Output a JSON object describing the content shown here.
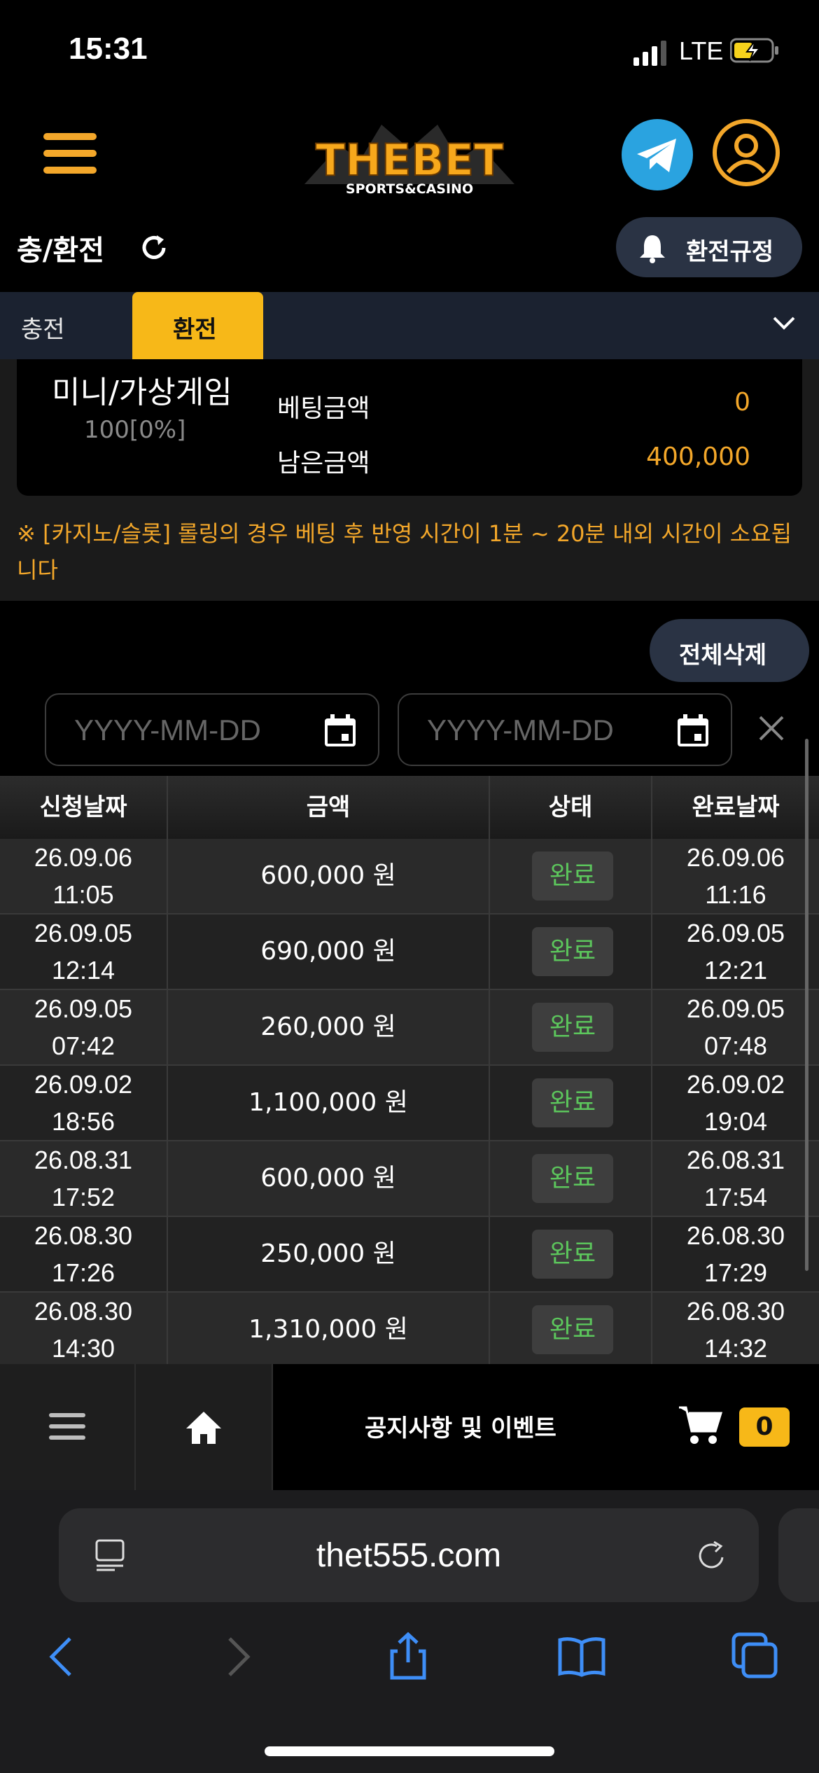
{
  "status_bar": {
    "time": "15:31",
    "network": "LTE"
  },
  "header": {
    "logo_main": "THEBET",
    "logo_sub": "SPORTS&CASINO"
  },
  "page": {
    "title": "충/환전",
    "rules_button": "환전규정"
  },
  "tabs": [
    {
      "label": "충전",
      "active": false
    },
    {
      "label": "환전",
      "active": true
    }
  ],
  "summary": {
    "game_name": "미니/가상게임",
    "game_rate": "100[0%]",
    "rows": [
      {
        "label": "베팅금액",
        "value": "0"
      },
      {
        "label": "남은금액",
        "value": "400,000"
      }
    ]
  },
  "notice": "※ [카지노/슬롯] 롤링의 경우 베팅 후 반영 시간이 1분 ~ 20분 내외 시간이 소요됩니다",
  "delete_all_button": "전체삭제",
  "filters": {
    "start_placeholder": "YYYY-MM-DD",
    "end_placeholder": "YYYY-MM-DD"
  },
  "table": {
    "headers": [
      "신청날짜",
      "금액",
      "상태",
      "완료날짜"
    ],
    "rows": [
      {
        "req_date": "26.09.06",
        "req_time": "11:05",
        "amount": "600,000 원",
        "status": "완료",
        "done_date": "26.09.06",
        "done_time": "11:16"
      },
      {
        "req_date": "26.09.05",
        "req_time": "12:14",
        "amount": "690,000 원",
        "status": "완료",
        "done_date": "26.09.05",
        "done_time": "12:21"
      },
      {
        "req_date": "26.09.05",
        "req_time": "07:42",
        "amount": "260,000 원",
        "status": "완료",
        "done_date": "26.09.05",
        "done_time": "07:48"
      },
      {
        "req_date": "26.09.02",
        "req_time": "18:56",
        "amount": "1,100,000 원",
        "status": "완료",
        "done_date": "26.09.02",
        "done_time": "19:04"
      },
      {
        "req_date": "26.08.31",
        "req_time": "17:52",
        "amount": "600,000 원",
        "status": "완료",
        "done_date": "26.08.31",
        "done_time": "17:54"
      },
      {
        "req_date": "26.08.30",
        "req_time": "17:26",
        "amount": "250,000 원",
        "status": "완료",
        "done_date": "26.08.30",
        "done_time": "17:29"
      },
      {
        "req_date": "26.08.30",
        "req_time": "14:30",
        "amount": "1,310,000 원",
        "status": "완료",
        "done_date": "26.08.30",
        "done_time": "14:32"
      }
    ]
  },
  "bottom_nav": {
    "notice_label": "공지사항 및 이벤트",
    "cart_count": "0"
  },
  "browser": {
    "url": "thet555.com"
  },
  "colors": {
    "accent": "#f7b818",
    "orange": "#f3a72a",
    "status_green": "#5cc65c",
    "pill_bg": "#2a3344"
  }
}
